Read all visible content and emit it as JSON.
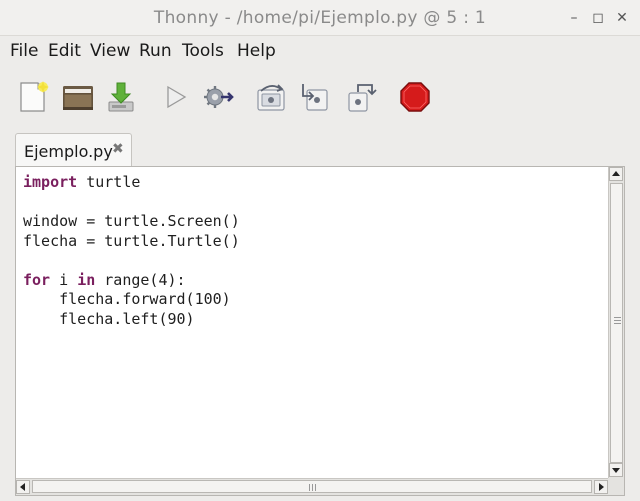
{
  "window": {
    "title": "Thonny  -  /home/pi/Ejemplo.py  @  5 : 1",
    "controls": {
      "minimize": "–",
      "maximize": "◻",
      "close": "✕"
    }
  },
  "menubar": {
    "items": [
      "File",
      "Edit",
      "View",
      "Run",
      "Tools",
      "Help"
    ]
  },
  "toolbar": {
    "buttons": [
      {
        "name": "new-file",
        "icon": "new-file-icon"
      },
      {
        "name": "open-file",
        "icon": "folder-icon"
      },
      {
        "name": "save-file",
        "icon": "save-icon"
      },
      {
        "name": "run",
        "icon": "play-icon"
      },
      {
        "name": "debug",
        "icon": "debug-icon"
      },
      {
        "name": "step-over",
        "icon": "step-over-icon"
      },
      {
        "name": "step-into",
        "icon": "step-into-icon"
      },
      {
        "name": "step-out",
        "icon": "step-out-icon"
      },
      {
        "name": "stop",
        "icon": "stop-icon"
      }
    ],
    "colors": {
      "stop": "#d51b1b",
      "new_file_star": "#f3e03a",
      "save_arrow": "#55a535"
    }
  },
  "editor": {
    "tab_label": "Ejemplo.py",
    "tab_close": "✖",
    "code_lines": [
      [
        {
          "t": "import",
          "kw": true
        },
        {
          "t": " turtle"
        }
      ],
      [],
      [
        {
          "t": "window = turtle.Screen()"
        }
      ],
      [
        {
          "t": "flecha = turtle.Turtle()"
        }
      ],
      [],
      [
        {
          "t": "for",
          "kw": true
        },
        {
          "t": " i "
        },
        {
          "t": "in",
          "kw": true
        },
        {
          "t": " range(4):"
        }
      ],
      [
        {
          "t": "    flecha.forward(100)"
        }
      ],
      [
        {
          "t": "    flecha.left(90)"
        }
      ]
    ],
    "keyword_color": "#7a1f5e"
  }
}
